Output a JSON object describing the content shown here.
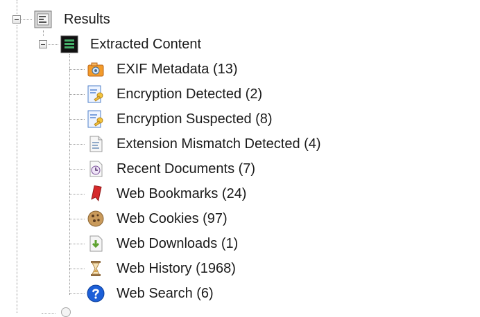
{
  "tree": {
    "results": {
      "label": "Results"
    },
    "extracted": {
      "label": "Extracted Content"
    },
    "items": [
      {
        "label": "EXIF Metadata (13)",
        "icon": "camera-icon"
      },
      {
        "label": "Encryption Detected (2)",
        "icon": "key-document-icon"
      },
      {
        "label": "Encryption Suspected (8)",
        "icon": "key-document-icon"
      },
      {
        "label": "Extension Mismatch Detected (4)",
        "icon": "document-mismatch-icon"
      },
      {
        "label": "Recent Documents (7)",
        "icon": "clock-document-icon"
      },
      {
        "label": "Web Bookmarks (24)",
        "icon": "bookmark-icon"
      },
      {
        "label": "Web Cookies (97)",
        "icon": "cookie-icon"
      },
      {
        "label": "Web Downloads (1)",
        "icon": "download-icon"
      },
      {
        "label": "Web History (1968)",
        "icon": "hourglass-icon"
      },
      {
        "label": "Web Search (6)",
        "icon": "help-search-icon"
      }
    ]
  }
}
